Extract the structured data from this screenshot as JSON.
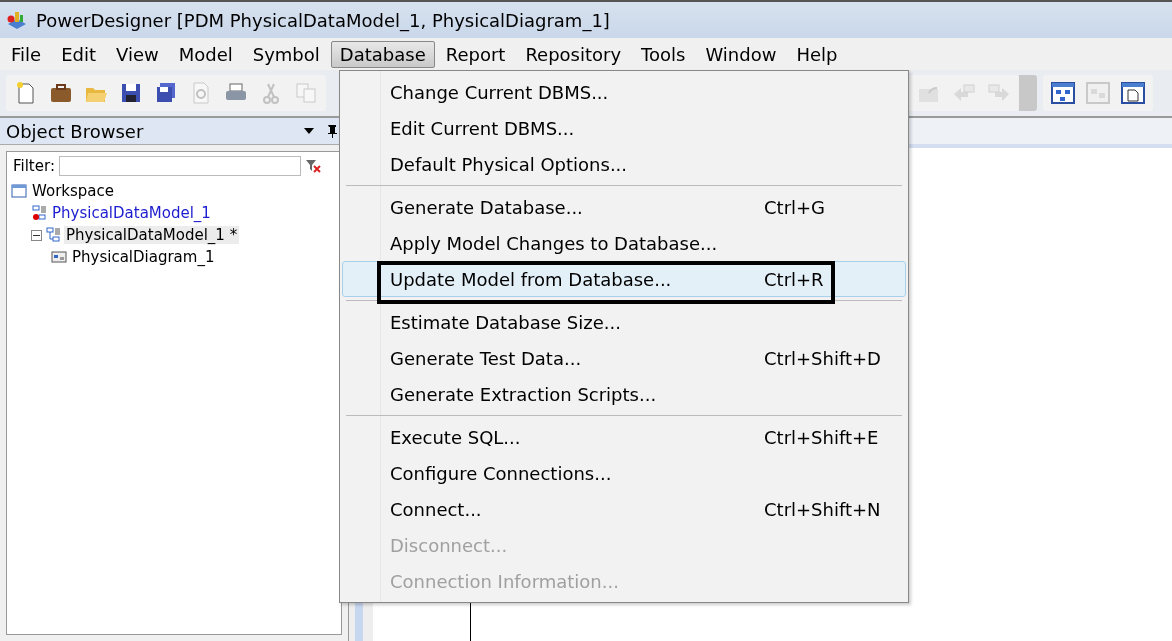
{
  "window": {
    "title": "PowerDesigner [PDM PhysicalDataModel_1, PhysicalDiagram_1]"
  },
  "menu_bar": [
    {
      "label": "File",
      "selected": false
    },
    {
      "label": "Edit",
      "selected": false
    },
    {
      "label": "View",
      "selected": false
    },
    {
      "label": "Model",
      "selected": false
    },
    {
      "label": "Symbol",
      "selected": false
    },
    {
      "label": "Database",
      "selected": true
    },
    {
      "label": "Report",
      "selected": false
    },
    {
      "label": "Repository",
      "selected": false
    },
    {
      "label": "Tools",
      "selected": false
    },
    {
      "label": "Window",
      "selected": false
    },
    {
      "label": "Help",
      "selected": false
    }
  ],
  "object_browser": {
    "title": "Object Browser",
    "filter_label": "Filter:",
    "tree": [
      {
        "label": "Workspace",
        "kind": "workspace",
        "selected": false,
        "color": "#000000",
        "children": [
          {
            "label": "PhysicalDataModel_1",
            "kind": "model-closed",
            "selected": false,
            "color": "#1c1cd0"
          },
          {
            "label": "PhysicalDataModel_1 *",
            "kind": "model",
            "selected": true,
            "color": "#000000",
            "expanded": true,
            "children": [
              {
                "label": "PhysicalDiagram_1",
                "kind": "diagram",
                "selected": false,
                "color": "#000000"
              }
            ]
          }
        ]
      }
    ]
  },
  "database_menu": [
    {
      "kind": "item",
      "label": "Change Current DBMS...",
      "disabled": false,
      "selected": false,
      "outlined": false
    },
    {
      "kind": "item",
      "label": "Edit Current DBMS...",
      "disabled": false,
      "selected": false,
      "outlined": false
    },
    {
      "kind": "item",
      "label": "Default Physical Options...",
      "disabled": false,
      "selected": false,
      "outlined": false
    },
    {
      "kind": "separator"
    },
    {
      "kind": "item",
      "label": "Generate Database...",
      "shortcut": "Ctrl+G",
      "disabled": false,
      "selected": false,
      "outlined": false
    },
    {
      "kind": "item",
      "label": "Apply Model Changes to Database...",
      "disabled": false,
      "selected": false,
      "outlined": false
    },
    {
      "kind": "item",
      "label": "Update Model from Database...",
      "shortcut": "Ctrl+R",
      "disabled": false,
      "selected": true,
      "outlined": true
    },
    {
      "kind": "separator"
    },
    {
      "kind": "item",
      "label": "Estimate Database Size...",
      "disabled": false,
      "selected": false,
      "outlined": false
    },
    {
      "kind": "item",
      "label": "Generate Test Data...",
      "shortcut": "Ctrl+Shift+D",
      "disabled": false,
      "selected": false,
      "outlined": false
    },
    {
      "kind": "item",
      "label": "Generate Extraction Scripts...",
      "disabled": false,
      "selected": false,
      "outlined": false
    },
    {
      "kind": "separator"
    },
    {
      "kind": "item",
      "label": "Execute SQL...",
      "shortcut": "Ctrl+Shift+E",
      "disabled": false,
      "selected": false,
      "outlined": false
    },
    {
      "kind": "item",
      "label": "Configure Connections...",
      "disabled": false,
      "selected": false,
      "outlined": false
    },
    {
      "kind": "item",
      "label": "Connect...",
      "shortcut": "Ctrl+Shift+N",
      "disabled": false,
      "selected": false,
      "outlined": false
    },
    {
      "kind": "item",
      "label": "Disconnect...",
      "disabled": true,
      "selected": false,
      "outlined": false
    },
    {
      "kind": "item",
      "label": "Connection Information...",
      "disabled": true,
      "selected": false,
      "outlined": false
    }
  ]
}
